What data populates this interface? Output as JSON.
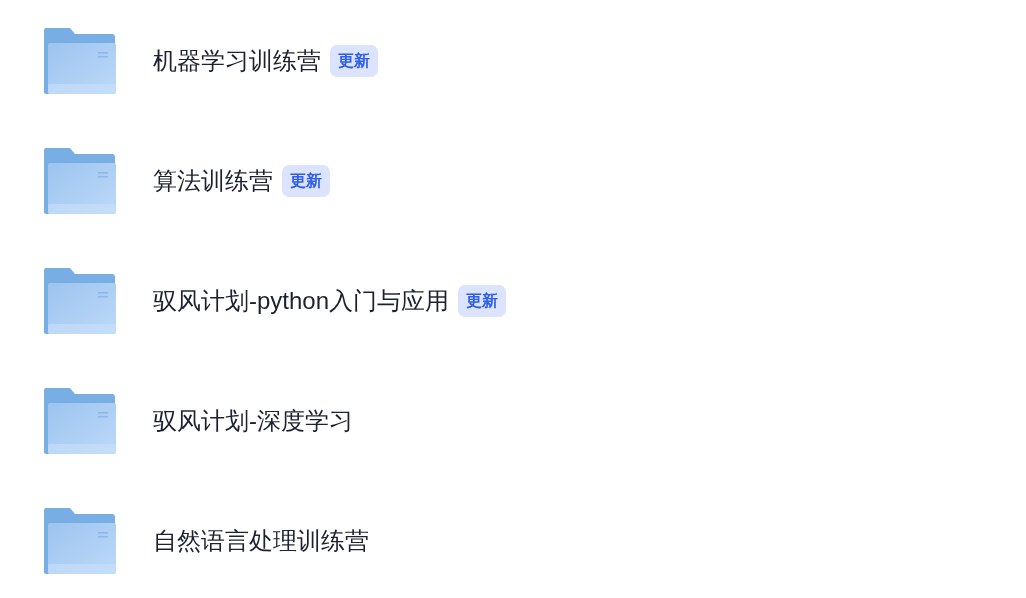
{
  "folders": [
    {
      "name": "机器学习训练营",
      "badge": "更新"
    },
    {
      "name": "算法训练营",
      "badge": "更新"
    },
    {
      "name": "驭风计划-python入门与应用",
      "badge": "更新"
    },
    {
      "name": "驭风计划-深度学习"
    },
    {
      "name": "自然语言处理训练营"
    }
  ]
}
